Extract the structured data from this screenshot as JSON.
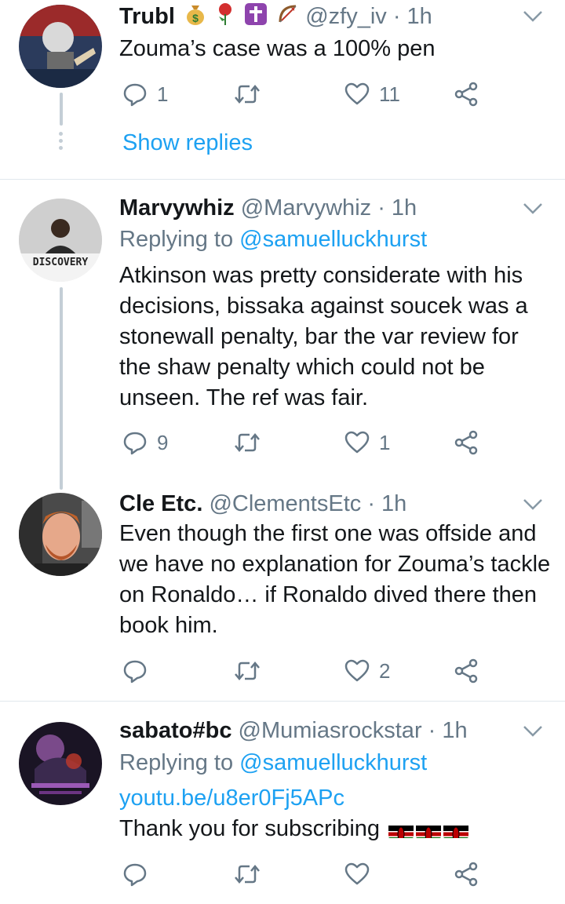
{
  "tweets": [
    {
      "name": "Trubl",
      "handle": "@zfy_iv",
      "time": "· 1h",
      "text": "Zouma’s case was a 100% pen",
      "replies": "1",
      "retweets": "",
      "likes": "11",
      "show_replies": "Show replies",
      "badges": [
        "money-bag-icon",
        "rose-icon",
        "latin-cross-icon",
        "bow-and-arrow-icon"
      ]
    },
    {
      "name": "Marvywhiz",
      "handle": "@Marvywhiz",
      "time": "· 1h",
      "replying_prefix": "Replying to",
      "replying_to": "@samuelluckhurst",
      "avatar_text": "DISCOVERY",
      "text": "Atkinson was pretty considerate with his decisions, bissaka against soucek was a stonewall penalty, bar the var review for the shaw penalty which could not be unseen. The ref was fair.",
      "replies": "9",
      "retweets": "",
      "likes": "1"
    },
    {
      "name": "Cle Etc.",
      "handle": "@ClementsEtc",
      "time": "· 1h",
      "text": "Even though the first one was offside and we have no explanation for Zouma’s tackle on Ronaldo… if Ronaldo dived there then book him.",
      "replies": "",
      "retweets": "",
      "likes": "2"
    },
    {
      "name": "sabato#bc",
      "handle": "@Mumiasrockstar",
      "time": "· 1h",
      "replying_prefix": "Replying to",
      "replying_to": "@samuelluckhurst",
      "link": "youtu.be/u8er0Fj5APc",
      "text": "Thank you for subscribing",
      "trailing_emoji": [
        "kenya-flag-icon",
        "kenya-flag-icon",
        "kenya-flag-icon"
      ],
      "replies": "",
      "retweets": "",
      "likes": ""
    }
  ],
  "colors": {
    "accent": "#1da1f2",
    "muted": "#657786",
    "text": "#14171a",
    "thread_line": "#c4ced6",
    "divider": "#e1e8ed"
  }
}
